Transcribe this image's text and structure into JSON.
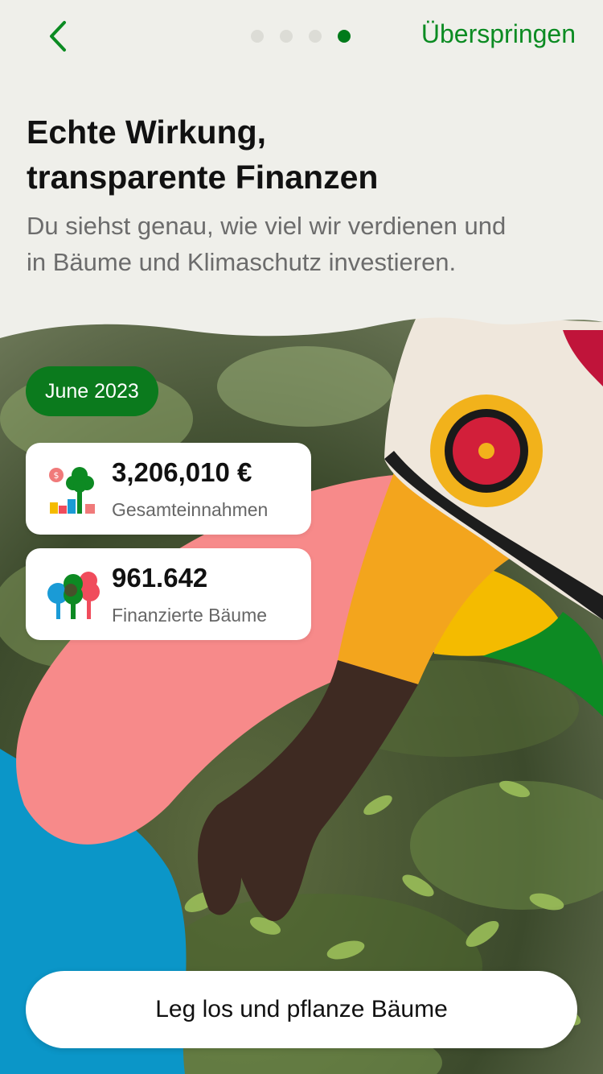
{
  "header": {
    "skip_label": "Überspringen",
    "title_line1": "Echte Wirkung,",
    "title_line2": "transparente Finanzen",
    "subtitle": "Du siehst genau, wie viel wir verdienen und\nin Bäume und Klimaschutz investieren."
  },
  "pager": {
    "total": 4,
    "active_index": 3
  },
  "badge": {
    "date": "June 2023"
  },
  "stats": [
    {
      "value": "3,206,010 €",
      "label": "Gesamteinnahmen",
      "icon": "revenue-chart-tree-icon"
    },
    {
      "value": "961.642",
      "label": "Finanzierte Bäume",
      "icon": "trees-icon"
    }
  ],
  "cta": {
    "label": "Leg los und pflanze Bäume"
  },
  "colors": {
    "accent_green": "#0b7a1d",
    "blob_pink": "#f78a8a",
    "blob_blue": "#0b96c8",
    "blob_yellow": "#f4bb00",
    "blob_green": "#0d8a23"
  }
}
